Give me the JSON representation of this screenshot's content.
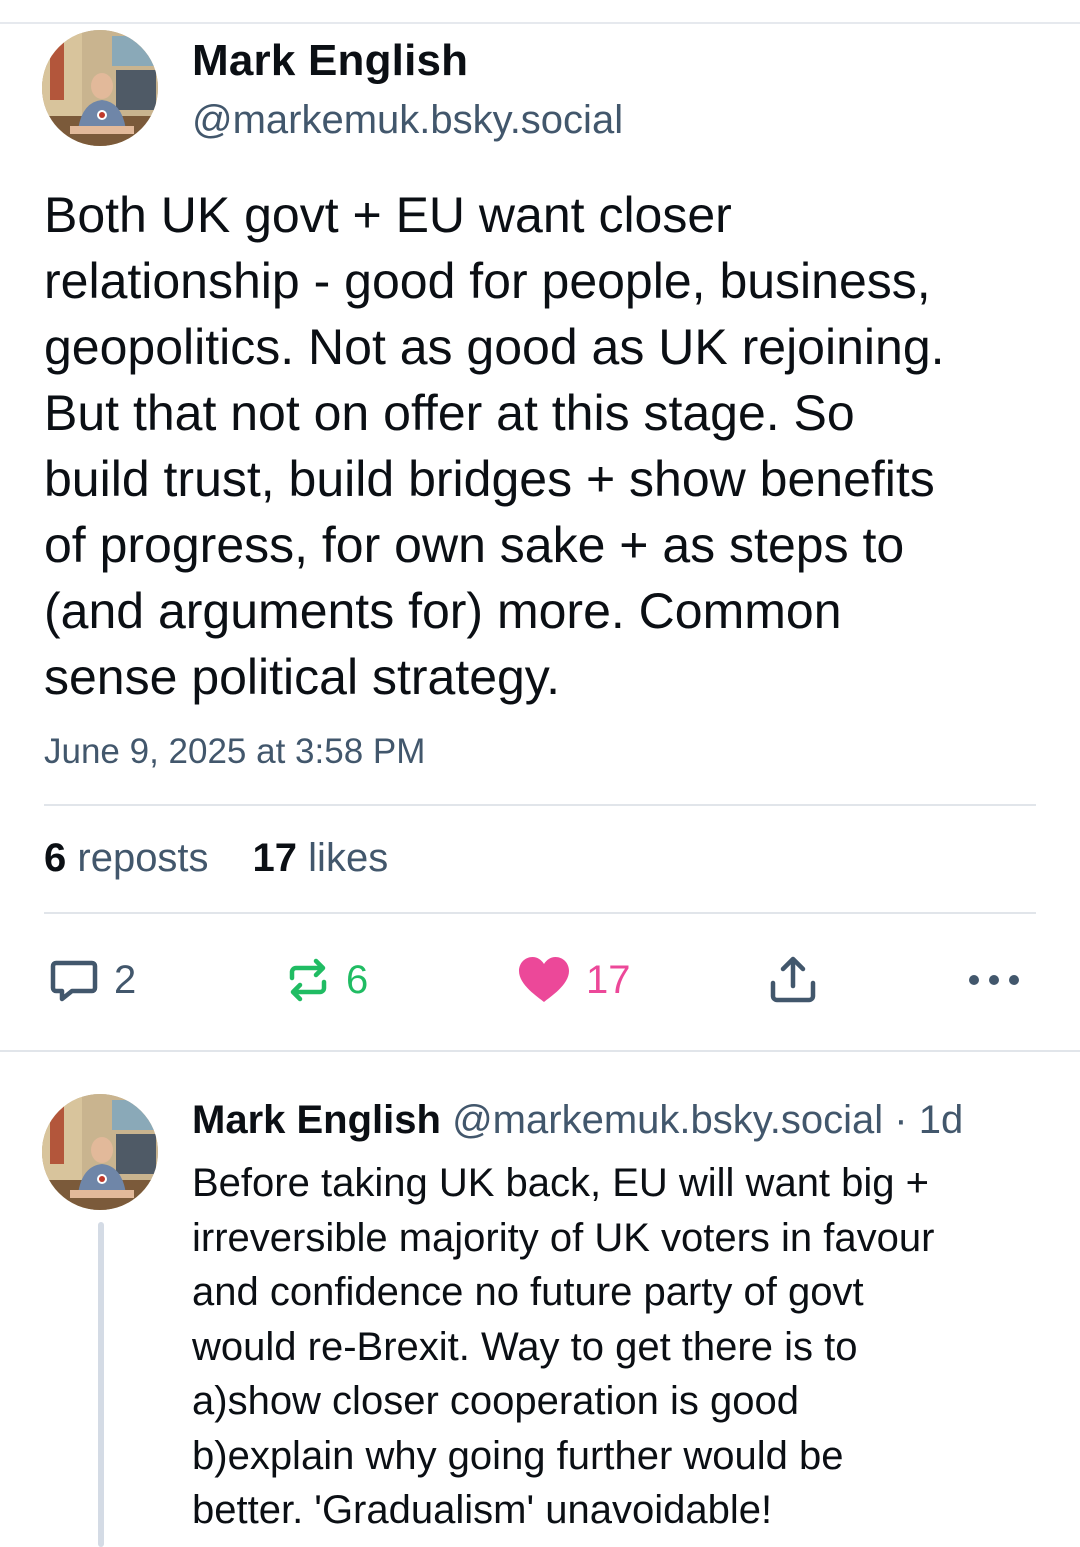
{
  "post": {
    "author": {
      "name": "Mark English",
      "handle": "@markemuk.bsky.social"
    },
    "text": "Both UK govt + EU want closer\nrelationship - good for people, business,\ngeopolitics. Not as good as UK rejoining.\nBut that not on offer at this stage. So\nbuild trust, build bridges + show benefits\nof progress, for own sake + as steps to\n(and arguments for) more. Common\nsense political strategy.",
    "timestamp": "June 9, 2025 at 3:58 PM",
    "stats": {
      "reposts_count": "6",
      "reposts_label": "reposts",
      "likes_count": "17",
      "likes_label": "likes"
    },
    "actions": {
      "reply": {
        "icon": "reply-icon",
        "count": "2"
      },
      "repost": {
        "icon": "repost-icon",
        "count": "6",
        "color": "#20bc63"
      },
      "like": {
        "icon": "heart-icon",
        "count": "17",
        "color": "#ec4899"
      },
      "share": {
        "icon": "share-icon"
      },
      "more": {
        "icon": "more-icon"
      }
    }
  },
  "reply": {
    "author": {
      "name": "Mark English",
      "handle_time": "@markemuk.bsky.social · 1d"
    },
    "text": "Before taking UK back, EU will want big +\nirreversible majority of UK voters in favour\nand confidence no future party of govt\nwould re-Brexit. Way to get there is to\na)show closer cooperation is good\nb)explain why going further would be\nbetter. 'Gradualism' unavoidable!"
  },
  "colors": {
    "text_primary": "#0b0f14",
    "text_secondary": "#42576c",
    "divider": "#e1e5ea",
    "repost_green": "#20bc63",
    "like_pink": "#ec4899"
  }
}
